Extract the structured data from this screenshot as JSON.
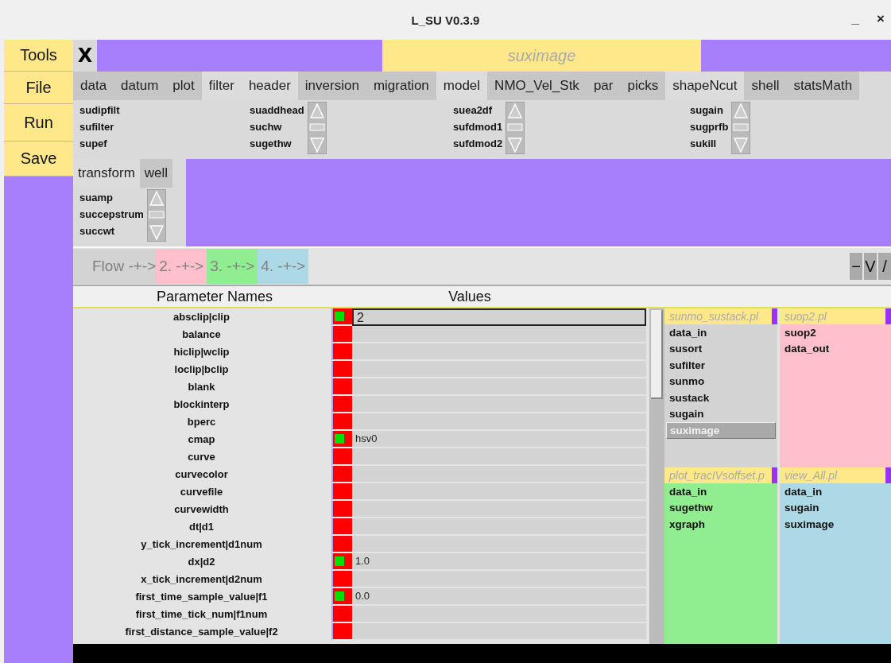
{
  "window": {
    "title": "L_SU V0.3.9",
    "controls": [
      "_",
      "×"
    ]
  },
  "sidebar": {
    "items": [
      "Tools",
      "File",
      "Run",
      "Save"
    ]
  },
  "toolbar": {
    "close": "X",
    "program": "suximage"
  },
  "tab_rows": [
    {
      "tabs": [
        {
          "label": "data",
          "selected": false
        },
        {
          "label": "datum",
          "selected": false
        },
        {
          "label": "plot",
          "selected": false
        },
        {
          "label": "filter",
          "selected": true
        },
        {
          "label": "header",
          "selected": true
        },
        {
          "label": "inversion",
          "selected": false
        },
        {
          "label": "migration",
          "selected": false
        },
        {
          "label": "model",
          "selected": true
        },
        {
          "label": "NMO_Vel_Stk",
          "selected": false
        },
        {
          "label": "par",
          "selected": false
        },
        {
          "label": "picks",
          "selected": false
        },
        {
          "label": "shapeNcut",
          "selected": true
        },
        {
          "label": "shell",
          "selected": false
        },
        {
          "label": "statsMath",
          "selected": false
        }
      ],
      "lists": [
        {
          "items": [
            "sudipfilt",
            "sufilter",
            "supef"
          ],
          "scrollbar": false
        },
        {
          "items": [
            "suaddhead",
            "suchw",
            "sugethw"
          ],
          "scrollbar": true
        },
        {
          "items": [
            "suea2df",
            "sufdmod1",
            "sufdmod2"
          ],
          "scrollbar": true
        },
        {
          "items": [
            "sugain",
            "sugprfb",
            "sukill"
          ],
          "scrollbar": true
        }
      ]
    },
    {
      "tabs": [
        {
          "label": "transform",
          "selected": true
        },
        {
          "label": "well",
          "selected": false
        }
      ],
      "lists": [
        {
          "items": [
            "suamp",
            "succepstrum",
            "succwt"
          ],
          "scrollbar": true
        }
      ]
    }
  ],
  "flow_buttons": [
    {
      "label": "Flow -+->",
      "color": "#d3d3d3"
    },
    {
      "label": "2. -+->",
      "color": "#ffc0cb"
    },
    {
      "label": "3. -+->",
      "color": "#90ee90"
    },
    {
      "label": "4. -+->",
      "color": "#add8e6"
    }
  ],
  "flow_controls": [
    "−",
    "V",
    "/"
  ],
  "parameters": {
    "columns": [
      "Parameter Names",
      "Values"
    ],
    "rows": [
      {
        "name": "absclip|clip",
        "on": true,
        "value": "2",
        "editing": true
      },
      {
        "name": "balance",
        "on": false
      },
      {
        "name": "hiclip|wclip",
        "on": false
      },
      {
        "name": "loclip|bclip",
        "on": false
      },
      {
        "name": "blank",
        "on": false
      },
      {
        "name": "blockinterp",
        "on": false
      },
      {
        "name": "bperc",
        "on": false
      },
      {
        "name": "cmap",
        "on": true,
        "value": "hsv0"
      },
      {
        "name": "curve",
        "on": false
      },
      {
        "name": "curvecolor",
        "on": false
      },
      {
        "name": "curvefile",
        "on": false
      },
      {
        "name": "curvewidth",
        "on": false
      },
      {
        "name": "dt|d1",
        "on": false
      },
      {
        "name": "y_tick_increment|d1num",
        "on": false
      },
      {
        "name": "dx|d2",
        "on": true,
        "value": "1.0"
      },
      {
        "name": "x_tick_increment|d2num",
        "on": false
      },
      {
        "name": "first_time_sample_value|f1",
        "on": true,
        "value": "0.0"
      },
      {
        "name": "first_time_tick_num|f1num",
        "on": false
      },
      {
        "name": "first_distance_sample_value|f2",
        "on": false
      }
    ]
  },
  "flows": [
    {
      "title": "sunmo_sustack.pl",
      "color": "#d3d3d3",
      "items": [
        {
          "label": "data_in",
          "selected": false
        },
        {
          "label": "susort",
          "selected": false
        },
        {
          "label": "sufilter",
          "selected": false
        },
        {
          "label": "sunmo",
          "selected": false
        },
        {
          "label": "sustack",
          "selected": false
        },
        {
          "label": "sugain",
          "selected": false
        },
        {
          "label": "suximage",
          "selected": true
        }
      ]
    },
    {
      "title": "suop2.pl",
      "color": "#ffc0cb",
      "items": [
        {
          "label": "suop2",
          "selected": false
        },
        {
          "label": "data_out",
          "selected": false
        }
      ]
    },
    {
      "title": "plot_tracIVsoffset.p",
      "color": "#90ee90",
      "items": [
        {
          "label": "data_in",
          "selected": false
        },
        {
          "label": "sugethw",
          "selected": false
        },
        {
          "label": "xgraph",
          "selected": false
        }
      ]
    },
    {
      "title": "view_All.pl",
      "color": "#add8e6",
      "items": [
        {
          "label": "data_in",
          "selected": false
        },
        {
          "label": "sugain",
          "selected": false
        },
        {
          "label": "suximage",
          "selected": false
        }
      ]
    }
  ]
}
